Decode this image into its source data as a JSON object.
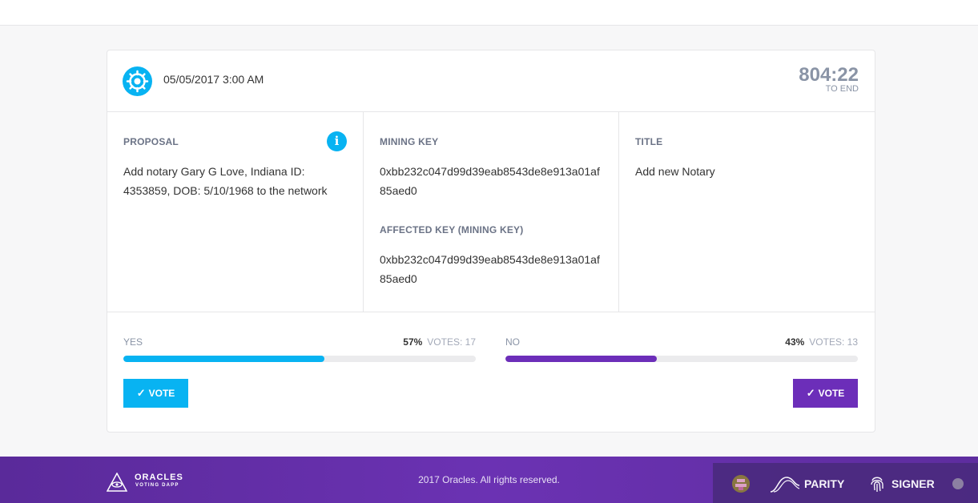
{
  "header": {
    "date": "05/05/2017 3:00 AM",
    "timer_value": "804:22",
    "timer_label": "TO END"
  },
  "details": {
    "proposal_label": "PROPOSAL",
    "proposal_text": "Add notary Gary G Love, Indiana ID: 4353859, DOB: 5/10/1968 to the network",
    "mining_key_label": "MINING KEY",
    "mining_key_value": "0xbb232c047d99d39eab8543de8e913a01af85aed0",
    "affected_key_label": "AFFECTED KEY (MINING KEY)",
    "affected_key_value": "0xbb232c047d99d39eab8543de8e913a01af85aed0",
    "title_label": "TITLE",
    "title_value": "Add new Notary",
    "info_icon": "i"
  },
  "votes": {
    "yes": {
      "label": "YES",
      "percent_text": "57%",
      "votes_text": "VOTES: 17",
      "fraction": 0.57,
      "button_label": "VOTE",
      "color": "#08b3f2"
    },
    "no": {
      "label": "NO",
      "percent_text": "43%",
      "votes_text": "VOTES: 13",
      "fraction": 0.43,
      "button_label": "VOTE",
      "color": "#6c2eb9"
    }
  },
  "footer": {
    "brand_name": "ORACLES",
    "brand_sub": "VOTING DAPP",
    "copyright": "2017 Oracles. All rights reserved.",
    "parity_label": "PARITY",
    "signer_label": "SIGNER"
  },
  "colors": {
    "accent_blue": "#08b3f2",
    "accent_purple": "#6c2eb9",
    "footer_bg": "#5a2a9a"
  }
}
